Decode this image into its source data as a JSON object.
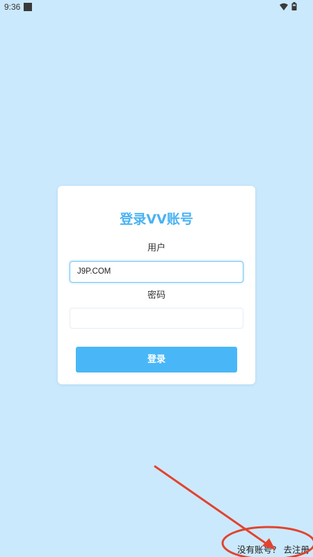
{
  "status_bar": {
    "time": "9:36"
  },
  "login_card": {
    "title": "登录VV账号",
    "username_label": "用户",
    "username_value": "J9P.COM",
    "password_label": "密码",
    "password_value": "",
    "login_button_label": "登录"
  },
  "footer": {
    "register_link": "没有账号？ 去注册"
  },
  "colors": {
    "background": "#cbe9fc",
    "accent": "#4ab2f2",
    "button": "#49b7f7",
    "annotation": "#e2432f"
  },
  "icons": [
    "wifi-icon",
    "battery-icon"
  ]
}
